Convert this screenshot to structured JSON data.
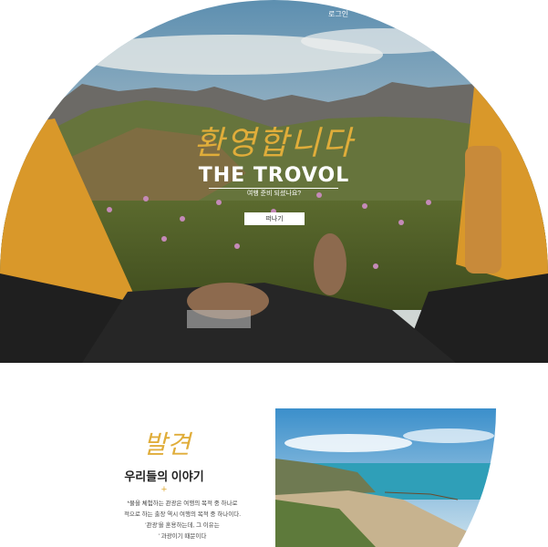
{
  "header": {
    "login_label": "로그인"
  },
  "hero": {
    "welcome": "환영합니다",
    "brand": "THE TROVOL",
    "subtitle": "여행 준비 되셨나요?",
    "cta_label": "떠나기"
  },
  "discover": {
    "title": "발견",
    "subtitle": "우리들의 이야기",
    "divider_glyph": "+",
    "paragraph": [
      "*물을 체험하는 관광은 여행의 목적 중 하나로",
      "적으로 하는 출장 역시 여행의 목적 중 하나이다.",
      "'관광'을 혼용하는데, 그 이유는",
      "' 과광이기 때문이다"
    ]
  },
  "colors": {
    "accent": "#e0ad3a",
    "text_dark": "#222222"
  }
}
